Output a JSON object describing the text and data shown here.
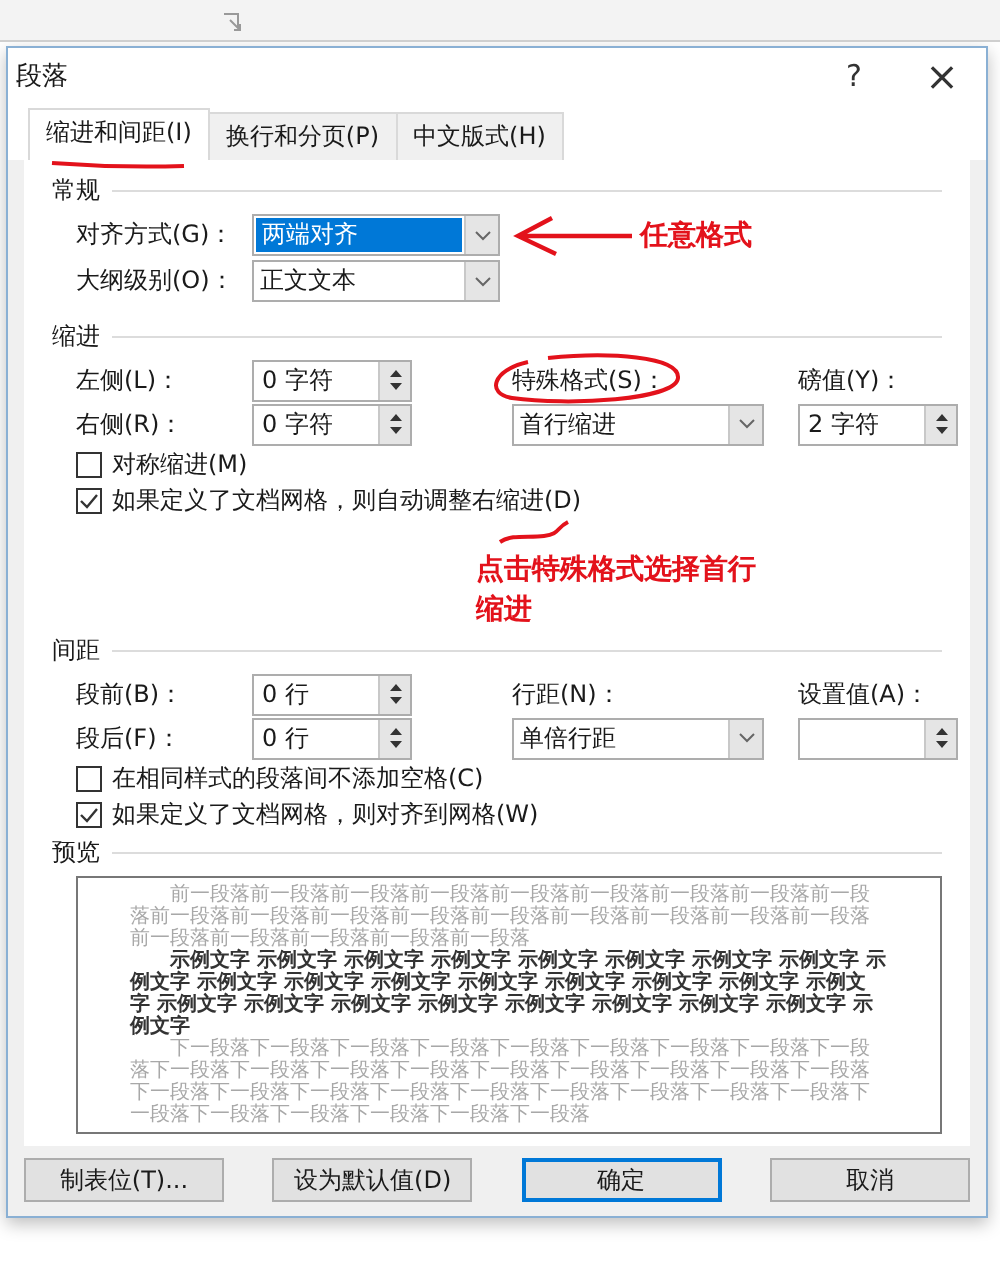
{
  "dialog": {
    "title": "段落",
    "help": "?",
    "close": "×"
  },
  "tabs": [
    {
      "label": "缩进和间距(I)",
      "selected": true
    },
    {
      "label": "换行和分页(P)",
      "selected": false
    },
    {
      "label": "中文版式(H)",
      "selected": false
    }
  ],
  "general": {
    "heading": "常规",
    "fields": [
      {
        "label": "对齐方式(G)：",
        "value": "两端对齐",
        "highlighted": true
      },
      {
        "label": "大纲级别(O)：",
        "value": "正文文本",
        "highlighted": false
      }
    ]
  },
  "indent": {
    "heading": "缩进",
    "left": {
      "label": "左侧(L)：",
      "value": "0 字符"
    },
    "right": {
      "label": "右侧(R)：",
      "value": "0 字符"
    },
    "special": {
      "label": "特殊格式(S)：",
      "value": "首行缩进"
    },
    "by": {
      "label": "磅值(Y)：",
      "value": "2 字符"
    },
    "checks": [
      {
        "label": "对称缩进(M)",
        "checked": false
      },
      {
        "label": "如果定义了文档网格，则自动调整右缩进(D)",
        "checked": true
      }
    ]
  },
  "spacing": {
    "heading": "间距",
    "before": {
      "label": "段前(B)：",
      "value": "0 行"
    },
    "after": {
      "label": "段后(F)：",
      "value": "0 行"
    },
    "line": {
      "label": "行距(N)：",
      "value": "单倍行距"
    },
    "at": {
      "label": "设置值(A)："
    },
    "checks": [
      {
        "label": "在相同样式的段落间不添加空格(C)",
        "checked": false
      },
      {
        "label": "如果定义了文档网格，则对齐到网格(W)",
        "checked": true
      }
    ]
  },
  "preview": {
    "heading": "预览",
    "previous": "前一段落前一段落前一段落前一段落前一段落前一段落前一段落前一段落前一段落前一段落前一段落前一段落前一段落前一段落前一段落前一段落前一段落前一段落前一段落前一段落前一段落前一段落前一段落",
    "sample": "示例文字 示例文字 示例文字 示例文字 示例文字 示例文字 示例文字 示例文字 示例文字 示例文字 示例文字 示例文字 示例文字 示例文字 示例文字 示例文字 示例文字 示例文字 示例文字 示例文字 示例文字 示例文字 示例文字 示例文字 示例文字 示例文字",
    "next": "下一段落下一段落下一段落下一段落下一段落下一段落下一段落下一段落下一段落下一段落下一段落下一段落下一段落下一段落下一段落下一段落下一段落下一段落下一段落下一段落下一段落下一段落下一段落下一段落下一段落下一段落下一段落下一段落下一段落下一段落下一段落下一段落下一段落"
  },
  "buttons": [
    {
      "label": "制表位(T)...",
      "default": false
    },
    {
      "label": "设为默认值(D)",
      "default": false
    },
    {
      "label": "确定",
      "default": true
    },
    {
      "label": "取消",
      "default": false
    }
  ],
  "annotations": [
    {
      "text": "任意格式"
    },
    {
      "text": "点击特殊格式选择首行缩进"
    }
  ]
}
